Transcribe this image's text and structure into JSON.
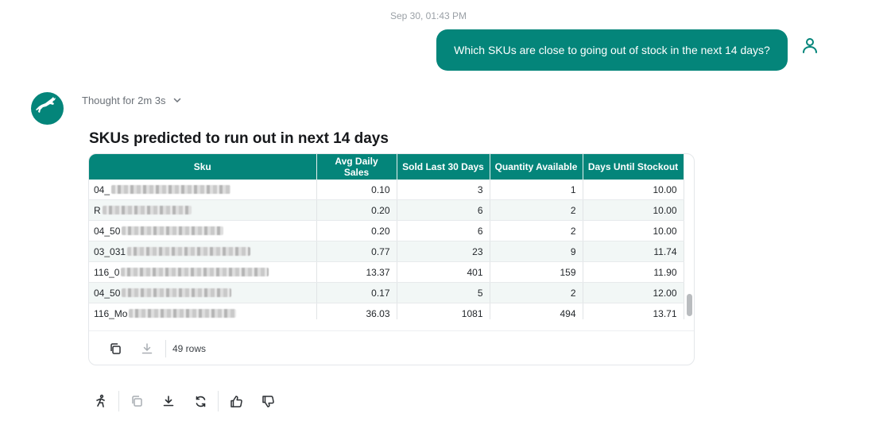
{
  "conversation": {
    "timestamp": "Sep 30, 01:43 PM",
    "user_message": "Which SKUs are close to going out of stock in the next 14 days?",
    "thought_label": "Thought for 2m 3s"
  },
  "result": {
    "title": "SKUs predicted to run out in next 14 days",
    "columns": [
      "Sku",
      "Avg Daily Sales",
      "Sold Last 30 Days",
      "Quantity Available",
      "Days Until Stockout"
    ],
    "rows": [
      {
        "sku": "04_",
        "avg": "0.10",
        "sold": "3",
        "qty": "1",
        "days": "10.00"
      },
      {
        "sku": "R",
        "avg": "0.20",
        "sold": "6",
        "qty": "2",
        "days": "10.00"
      },
      {
        "sku": "04_50",
        "avg": "0.20",
        "sold": "6",
        "qty": "2",
        "days": "10.00"
      },
      {
        "sku": "03_031",
        "avg": "0.77",
        "sold": "23",
        "qty": "9",
        "days": "11.74"
      },
      {
        "sku": "116_0",
        "avg": "13.37",
        "sold": "401",
        "qty": "159",
        "days": "11.90"
      },
      {
        "sku": "04_50",
        "avg": "0.17",
        "sold": "5",
        "qty": "2",
        "days": "12.00"
      },
      {
        "sku": "116_Mo",
        "avg": "36.03",
        "sold": "1081",
        "qty": "494",
        "days": "13.71"
      }
    ],
    "row_count": "49 rows"
  },
  "icons": {
    "user": "user-icon",
    "bot": "deer-logo-icon",
    "chevron": "chevron-down-icon",
    "copy": "copy-icon",
    "download": "download-icon",
    "rerun": "refresh-icon",
    "like": "thumbs-up-icon",
    "dislike": "thumbs-down-icon",
    "accessibility": "accessibility-icon"
  },
  "colors": {
    "accent": "#04857a",
    "stripe": "#f2f7f6"
  }
}
